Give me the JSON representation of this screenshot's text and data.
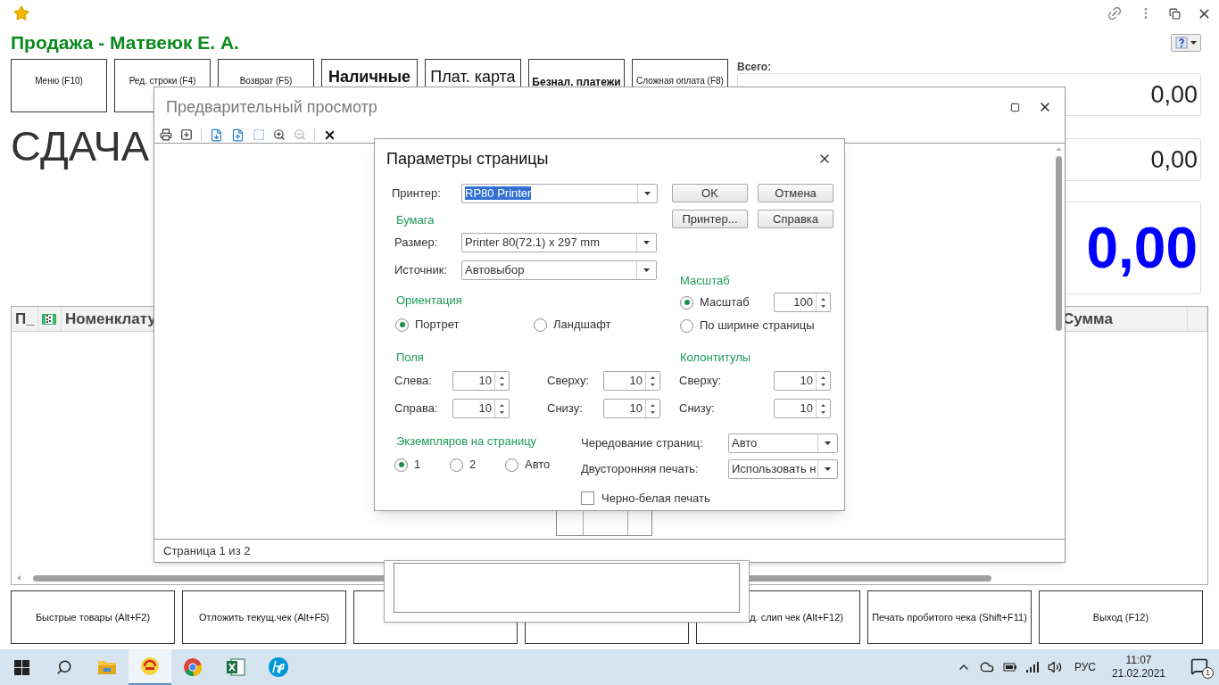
{
  "title": "Продажа - Матвеюк Е. А.",
  "top_buttons": [
    {
      "label": "Меню (F10)",
      "kind": "small"
    },
    {
      "label": "Ред. строки (F4)",
      "kind": "small"
    },
    {
      "label": "Возврат (F5)",
      "kind": "small"
    },
    {
      "label": "Наличные",
      "kind": "large-bold"
    },
    {
      "label": "Плат. карта",
      "kind": "large"
    },
    {
      "label": "Безнал. платежи",
      "kind": "medium-bold"
    },
    {
      "label": "Сложная оплата (F8)",
      "kind": "small"
    }
  ],
  "totals": {
    "label": "Всего:",
    "fields": [
      {
        "value": "0,00",
        "kind": "normal"
      },
      {
        "value": "0,00",
        "kind": "normal"
      },
      {
        "value": "0,00",
        "kind": "large"
      }
    ]
  },
  "change_label": "СДАЧА",
  "table": {
    "columns": [
      {
        "kind": "narrow",
        "label": "П_"
      },
      {
        "kind": "icon"
      },
      {
        "kind": "wide",
        "label": "Номенклату"
      },
      {
        "kind": "amount",
        "label": "Сумма"
      },
      {
        "kind": "blank"
      }
    ]
  },
  "bottom_buttons": [
    {
      "kind": "normal",
      "label": "Быстрые товары (Alt+F2)"
    },
    {
      "kind": "normal",
      "label": "Отложить текущ.чек (Alt+F5)"
    },
    {
      "kind": "covered"
    },
    {
      "kind": "covered"
    },
    {
      "kind": "partly-covered",
      "label": "д. слип чек (Alt+F12)"
    },
    {
      "kind": "normal",
      "label": "Печать пробитого чека (Shift+F11)"
    },
    {
      "kind": "normal",
      "label": "Выход (F12)"
    }
  ],
  "preview": {
    "title": "Предварительный просмотр",
    "status": "Страница 1 из 2"
  },
  "dialog": {
    "title": "Параметры страницы",
    "printer": {
      "label": "Принтер:",
      "value": "RP80 Printer"
    },
    "buttons": [
      "OK",
      "Отмена",
      "Принтер...",
      "Справка"
    ],
    "paper": {
      "title": "Бумага",
      "size_label": "Размер:",
      "size": "Printer 80(72.1) x 297 mm",
      "source_label": "Источник:",
      "source": "Автовыбор"
    },
    "orientation": {
      "title": "Ориентация",
      "options": [
        {
          "label": "Портрет",
          "selected": true
        },
        {
          "label": "Ландшафт",
          "selected": false
        }
      ]
    },
    "scale": {
      "title": "Масштаб",
      "options": [
        {
          "label": "Масштаб",
          "selected": true,
          "value": "100"
        },
        {
          "label": "По ширине страницы",
          "selected": false
        }
      ]
    },
    "margins": {
      "title": "Поля",
      "fields": [
        {
          "label": "Слева:",
          "value": "10"
        },
        {
          "label": "Сверху:",
          "value": "10"
        },
        {
          "label": "Справа:",
          "value": "10"
        },
        {
          "label": "Снизу:",
          "value": "10"
        }
      ]
    },
    "headers": {
      "title": "Колонтитулы",
      "fields": [
        {
          "label": "Сверху:",
          "value": "10"
        },
        {
          "label": "Снизу:",
          "value": "10"
        }
      ]
    },
    "copies": {
      "title": "Экземпляров на страницу",
      "options": [
        {
          "label": "1",
          "selected": true
        },
        {
          "label": "2",
          "selected": false
        },
        {
          "label": "Авто",
          "selected": false
        }
      ]
    },
    "collate": {
      "label": "Чередование страниц:",
      "value": "Авто"
    },
    "duplex": {
      "label": "Двусторонняя печать:",
      "value": "Использовать н"
    },
    "black_white": {
      "label": "Черно-белая печать",
      "checked": false
    }
  },
  "taskbar": {
    "apps": [
      {
        "kind": "files",
        "active": false
      },
      {
        "kind": "onec",
        "active": true
      },
      {
        "kind": "browser",
        "active": false
      },
      {
        "kind": "sheet",
        "active": false
      },
      {
        "kind": "hp",
        "active": false
      }
    ],
    "language": "РУС",
    "time": "11:07",
    "date": "21.02.2021",
    "notifications": "1"
  }
}
